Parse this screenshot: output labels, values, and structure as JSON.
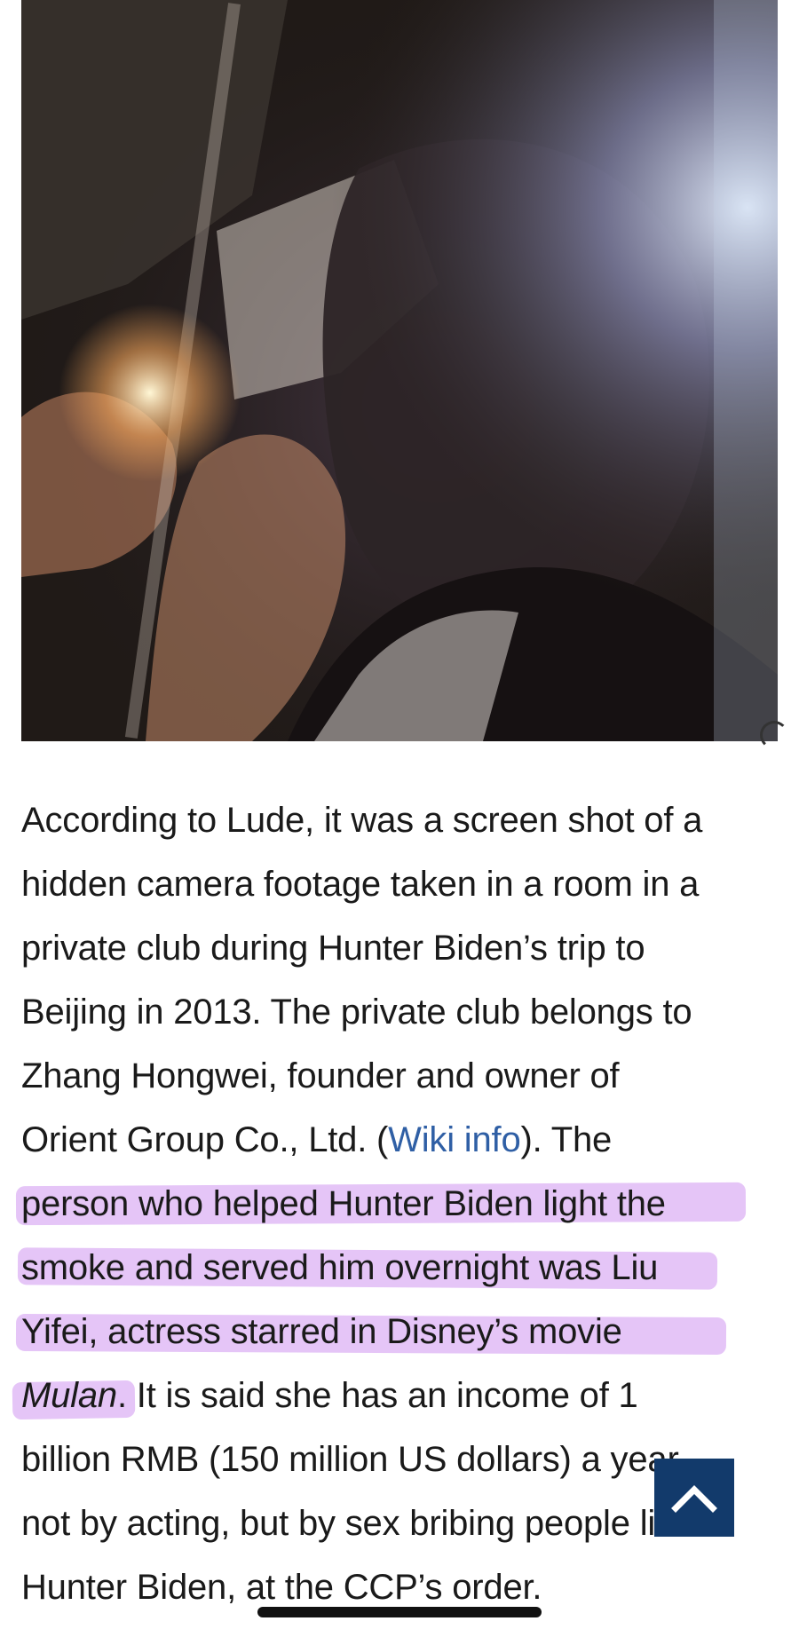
{
  "article": {
    "lines": [
      {
        "type": "text",
        "text": "According to Lude, it was a screen shot of a"
      },
      {
        "type": "text",
        "text": "hidden camera footage taken in a room in a"
      },
      {
        "type": "text",
        "text": "private club during Hunter Biden’s trip to"
      },
      {
        "type": "text",
        "text": "Beijing in 2013. The private club belongs to"
      },
      {
        "type": "text",
        "text": "Zhang Hongwei, founder and owner of"
      },
      {
        "type": "link",
        "before": "Orient Group Co., Ltd. (",
        "link": "Wiki info",
        "after": "). The"
      },
      {
        "type": "text",
        "text": "person who helped Hunter Biden light the"
      },
      {
        "type": "text",
        "text": "smoke and served him overnight was Liu"
      },
      {
        "type": "text",
        "text": "Yifei, actress starred in Disney’s movie"
      },
      {
        "type": "italic",
        "italic": "Mulan",
        "after": ". It is said she has an income of 1"
      },
      {
        "type": "text",
        "text": "billion RMB (150 million US dollars) a year"
      },
      {
        "type": "text",
        "text": "not by acting, but by sex bribing people like"
      },
      {
        "type": "text",
        "text": "Hunter Biden, at the CCP’s order."
      }
    ]
  },
  "colors": {
    "link": "#2f5fa5",
    "highlight": "#d096f0",
    "scroll_button": "#123a6b"
  },
  "icons": {
    "scroll_top": "chevron-up-icon"
  }
}
